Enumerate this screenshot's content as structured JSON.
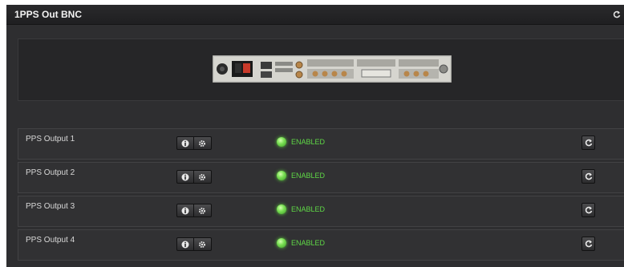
{
  "panel": {
    "title": "1PPS Out BNC",
    "refresh_icon": "refresh-icon",
    "device_image": "rear-panel-image"
  },
  "outputs": [
    {
      "label": "PPS Output 1",
      "status": "ENABLED"
    },
    {
      "label": "PPS Output 2",
      "status": "ENABLED"
    },
    {
      "label": "PPS Output 3",
      "status": "ENABLED"
    },
    {
      "label": "PPS Output 4",
      "status": "ENABLED"
    }
  ],
  "icons": {
    "info": "info-icon",
    "settings": "gear-icon",
    "refresh": "refresh-icon",
    "status": "status-led-icon"
  },
  "colors": {
    "panel_bg": "#2e2e30",
    "row_bg": "#313133",
    "enabled": "#5fd846"
  }
}
